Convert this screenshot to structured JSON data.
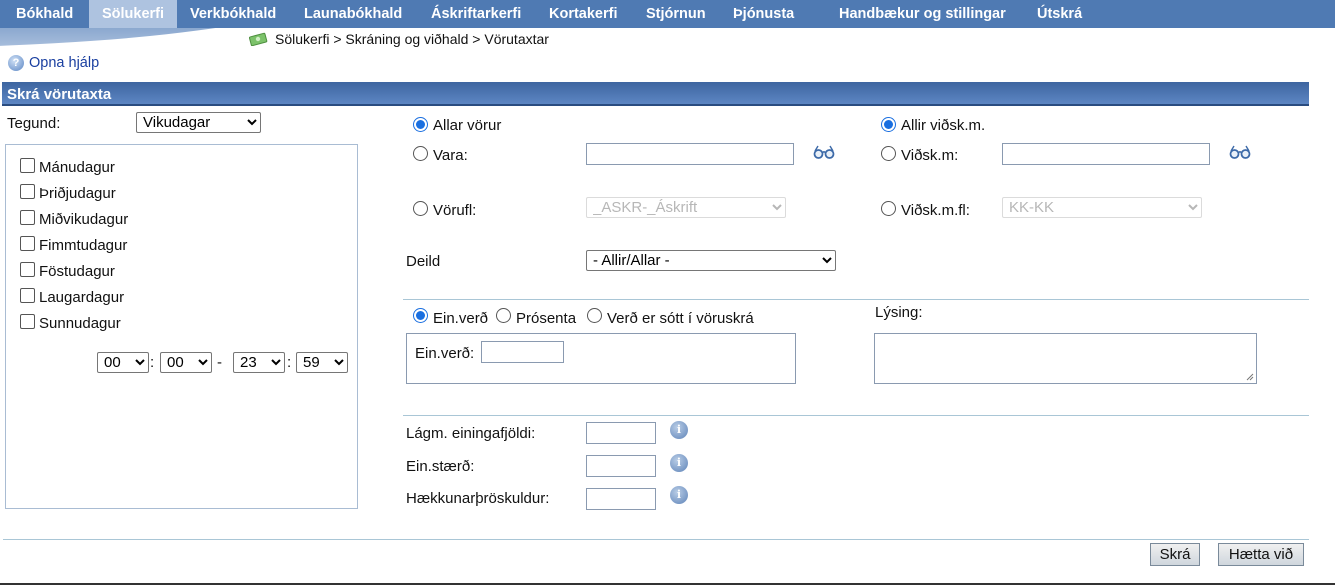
{
  "nav": {
    "items": [
      {
        "label": "Bókhald"
      },
      {
        "label": "Sölukerfi"
      },
      {
        "label": "Verkbókhald"
      },
      {
        "label": "Launabókhald"
      },
      {
        "label": "Áskriftarkerfi"
      },
      {
        "label": "Kortakerfi"
      },
      {
        "label": "Stjórnun"
      },
      {
        "label": "Þjónusta"
      },
      {
        "label": "Handbækur og stillingar"
      },
      {
        "label": "Útskrá"
      }
    ],
    "active": "Sölukerfi",
    "breadcrumb": "Sölukerfi > Skráning og viðhald > Vörutaxtar"
  },
  "help": {
    "label": "Opna hjálp"
  },
  "panel": {
    "title": "Skrá vörutaxta"
  },
  "type": {
    "label": "Tegund:",
    "value": "Vikudagar"
  },
  "days": [
    "Mánudagur",
    "Þriðjudagur",
    "Miðvikudagur",
    "Fimmtudagur",
    "Föstudagur",
    "Laugardagur",
    "Sunnudagur"
  ],
  "time": {
    "from_h": "00",
    "from_m": "00",
    "to_h": "23",
    "to_m": "59",
    "sep": ":",
    "dash": "-"
  },
  "product": {
    "all_label": "Allar vörur",
    "item_label": "Vara:",
    "group_label": "Vörufl:",
    "group_value": "_ASKR-_Áskrift"
  },
  "customer": {
    "all_label": "Allir viðsk.m.",
    "item_label": "Viðsk.m:",
    "group_label": "Viðsk.m.fl:",
    "group_value": "KK-KK"
  },
  "department": {
    "label": "Deild",
    "value": "- Allir/Allar -"
  },
  "pricing": {
    "unit_label": "Ein.verð",
    "percent_label": "Prósenta",
    "catalog_label": "Verð er sótt í vöruskrá",
    "price_field_label": "Ein.verð:"
  },
  "description": {
    "label": "Lýsing:"
  },
  "extra": {
    "min_qty_label": "Lágm. einingafjöldi:",
    "unit_size_label": "Ein.stærð:",
    "threshold_label": "Hækkunarþröskuldur:"
  },
  "buttons": {
    "save": "Skrá",
    "cancel": "Hætta við"
  },
  "colors": {
    "nav_bg": "#4f7ab3",
    "nav_active": "#aec3e0",
    "title_bg": "#4a72ad"
  }
}
